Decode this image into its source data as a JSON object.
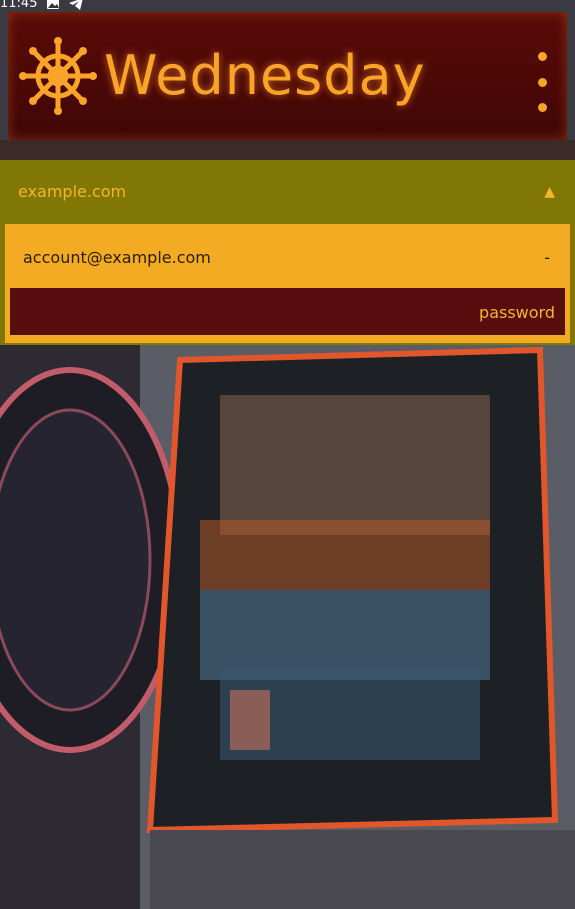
{
  "status_bar": {
    "time": "11:45",
    "icons": [
      "image-icon",
      "telegram-icon"
    ]
  },
  "app_bar": {
    "title": "Wednesday",
    "logo_icon": "ship-wheel-icon",
    "menu_icon": "more-vert-icon"
  },
  "domain": {
    "label": "example.com",
    "toggle_glyph": "▲"
  },
  "account": {
    "label": "account@example.com",
    "dash": "-",
    "password_label": "password"
  },
  "colors": {
    "accent": "#f8a428",
    "app_bar": "#4e0a07",
    "panel": "#807704",
    "card": "#f4ab24",
    "password_bg": "#580e0e"
  }
}
